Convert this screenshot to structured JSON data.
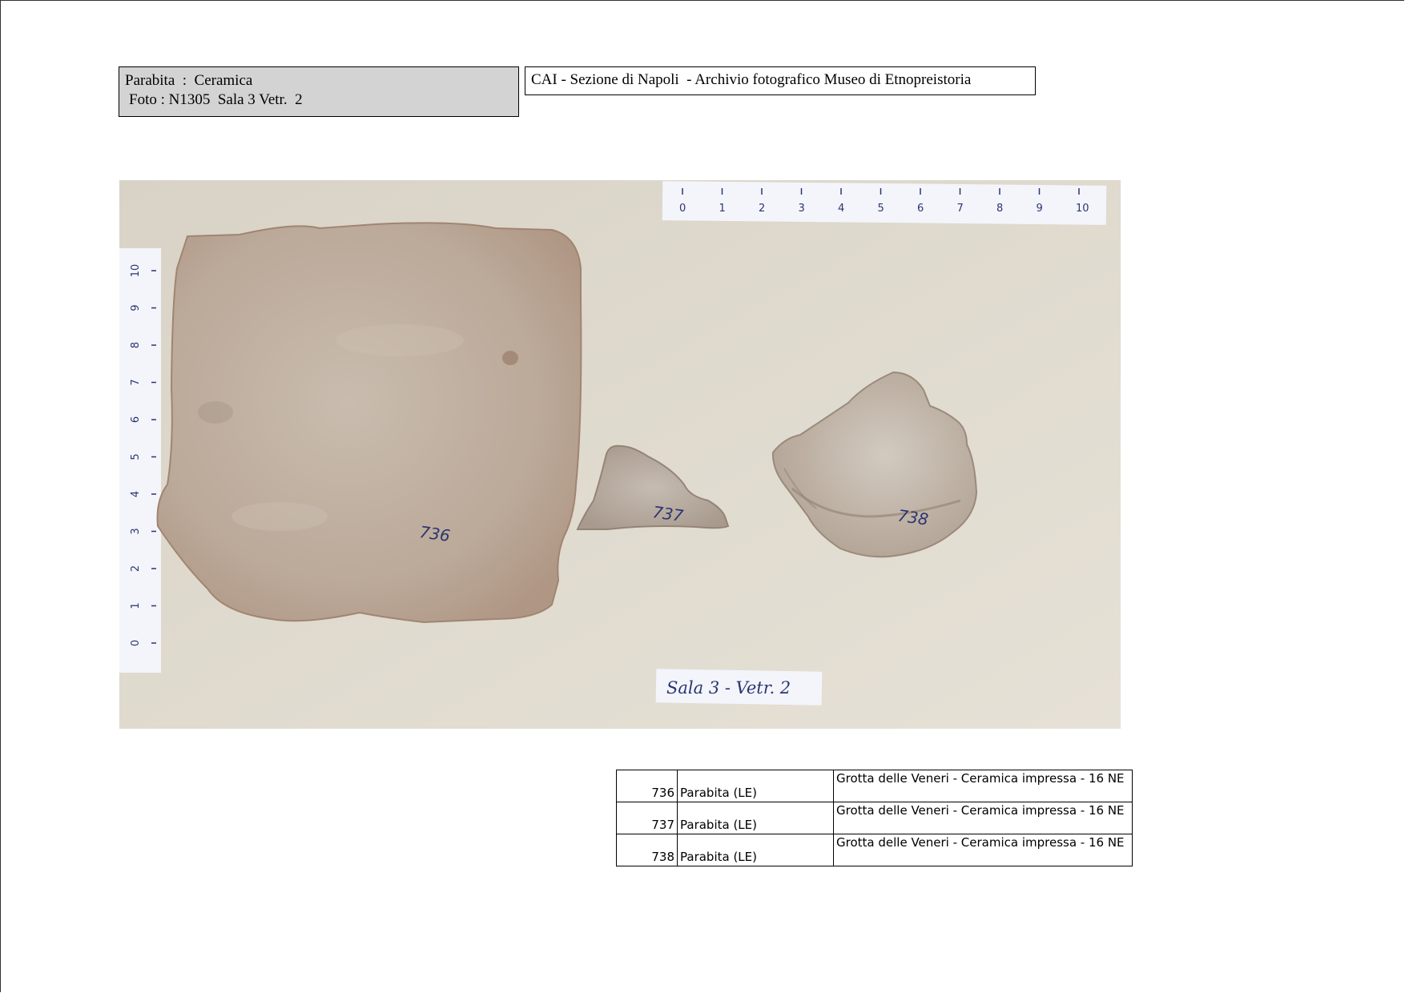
{
  "header": {
    "site_line": "Parabita  :  Ceramica",
    "photo_line": "Foto : N1305  Sala 3 Vetr.  2",
    "archive_label": "CAI - Sezione di Napoli  - Archivio fotografico Museo di Etnopreistoria"
  },
  "photo": {
    "top_ruler_ticks": [
      "0",
      "1",
      "2",
      "3",
      "4",
      "5",
      "6",
      "7",
      "8",
      "9",
      "10"
    ],
    "left_ruler_ticks": [
      "0",
      "1",
      "2",
      "3",
      "4",
      "5",
      "6",
      "7",
      "8",
      "9",
      "10"
    ],
    "fragment_labels": [
      "736",
      "737",
      "738"
    ],
    "case_card": "Sala 3 - Vetr. 2",
    "colors": {
      "background": "#e2dcd0",
      "sherd": "#bfae9e",
      "ruler": "#f3f5fb",
      "ink": "#2b3570"
    }
  },
  "catalog": {
    "rows": [
      {
        "number": "736",
        "place": "Parabita (LE)",
        "description": "Grotta delle Veneri - Ceramica impressa - 16 NE"
      },
      {
        "number": "737",
        "place": "Parabita (LE)",
        "description": "Grotta delle Veneri - Ceramica impressa - 16 NE"
      },
      {
        "number": "738",
        "place": "Parabita (LE)",
        "description": "Grotta delle Veneri - Ceramica impressa - 16 NE"
      }
    ]
  }
}
